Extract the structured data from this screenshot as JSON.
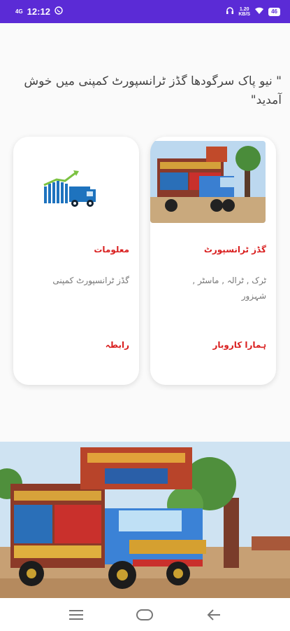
{
  "status_bar": {
    "network": "4G",
    "time": "12:12",
    "speed_value": "1.20",
    "speed_unit": "KB/S",
    "battery": "46"
  },
  "welcome_text": "\" نیو پاک سرگودھا گڈز ٹرانسپورٹ کمپنی میں خوش آمدید\"",
  "cards": [
    {
      "title": "گڈز ٹرانسپورٹ",
      "description": "ٹرک , ٹرالہ , ماسٹر , شہزور",
      "link": "ہمارا کاروبار",
      "image_icon": "truck-photo"
    },
    {
      "title": "معلومات",
      "description": "گڈز ٹرانسپورٹ کمپنی",
      "link": "رابطہ",
      "image_icon": "truck-growth-chart-icon"
    }
  ],
  "colors": {
    "status_bar": "#5b2bd6",
    "accent_red": "#d91f1f",
    "card_bg": "#ffffff"
  },
  "nav": [
    "menu-icon",
    "home-icon",
    "back-icon"
  ]
}
